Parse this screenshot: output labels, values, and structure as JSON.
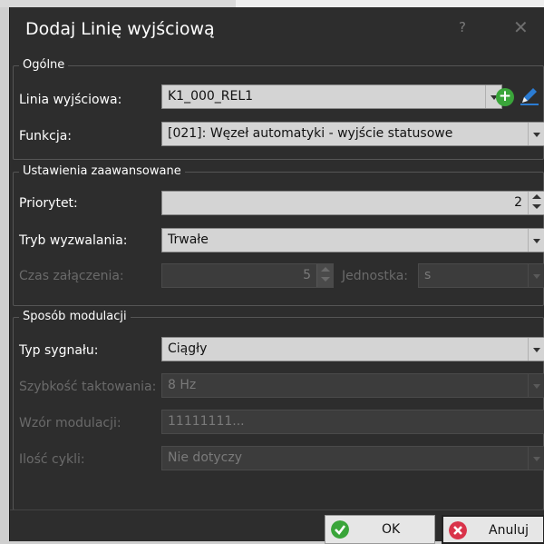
{
  "window": {
    "title": "Dodaj Linię wyjściową",
    "help": "?",
    "close": "✕"
  },
  "general": {
    "legend": "Ogólne",
    "output_line": {
      "label": "Linia wyjściowa:",
      "value": "K1_000_REL1"
    },
    "function": {
      "label": "Funkcja:",
      "value": "[021]: Węzeł automatyki - wyjście statusowe"
    }
  },
  "advanced": {
    "legend": "Ustawienia zaawansowane",
    "priority": {
      "label": "Priorytet:",
      "value": "2"
    },
    "trigger_mode": {
      "label": "Tryb wyzwalania:",
      "value": "Trwałe"
    },
    "on_time": {
      "label": "Czas załączenia:",
      "value": "5"
    },
    "unit": {
      "label": "Jednostka:",
      "value": "s"
    }
  },
  "modulation": {
    "legend": "Sposób modulacji",
    "signal_type": {
      "label": "Typ sygnału:",
      "value": "Ciągły"
    },
    "clock_speed": {
      "label": "Szybkość taktowania:",
      "value": "8 Hz"
    },
    "pattern": {
      "label": "Wzór modulacji:",
      "value": "11111111..."
    },
    "cycles": {
      "label": "Ilość cykli:",
      "value": "Nie dotyczy"
    }
  },
  "buttons": {
    "ok": "OK",
    "cancel": "Anuluj"
  },
  "colors": {
    "ok": "#3aa53a",
    "cancel": "#d9334a",
    "add": "#3aa53a",
    "edit": "#2b7cd3"
  }
}
